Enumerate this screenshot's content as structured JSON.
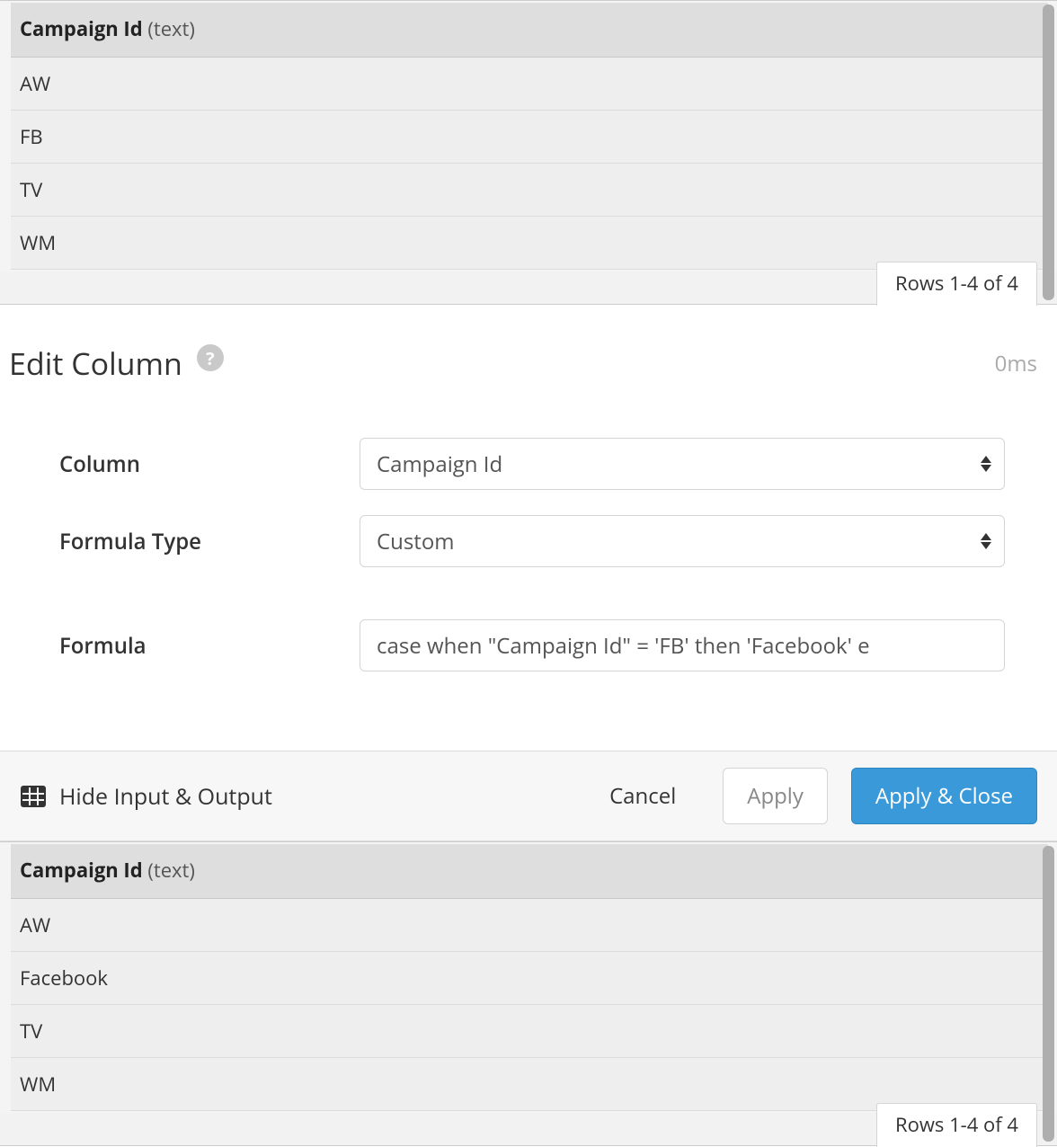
{
  "input_table": {
    "column_name": "Campaign Id",
    "column_type": "(text)",
    "rows": [
      "AW",
      "FB",
      "TV",
      "WM"
    ],
    "rows_status": "Rows 1-4 of 4"
  },
  "edit_panel": {
    "title": "Edit Column",
    "help_glyph": "?",
    "timing": "0ms",
    "labels": {
      "column": "Column",
      "formula_type": "Formula Type",
      "formula": "Formula"
    },
    "values": {
      "column": "Campaign Id",
      "formula_type": "Custom",
      "formula": "case when \"Campaign Id\" = 'FB' then 'Facebook' e"
    }
  },
  "footer": {
    "toggle": "Hide Input & Output",
    "cancel": "Cancel",
    "apply": "Apply",
    "apply_close": "Apply & Close"
  },
  "output_table": {
    "column_name": "Campaign Id",
    "column_type": "(text)",
    "rows": [
      "AW",
      "Facebook",
      "TV",
      "WM"
    ],
    "rows_status": "Rows 1-4 of 4"
  }
}
